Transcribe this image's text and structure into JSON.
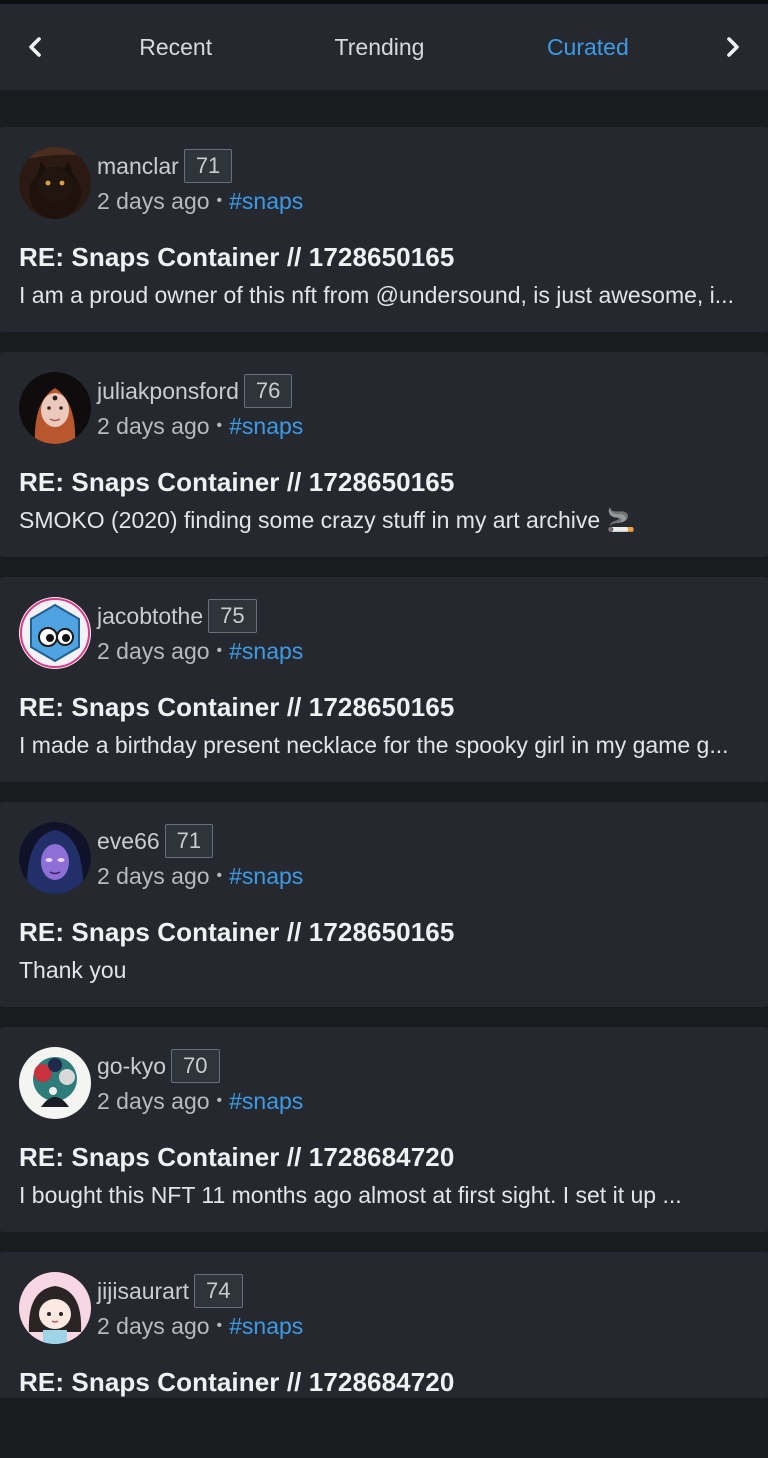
{
  "tabs": {
    "prev_icon": "chevron-left-icon",
    "next_icon": "chevron-right-icon",
    "items": [
      {
        "label": "Recent",
        "active": false
      },
      {
        "label": "Trending",
        "active": false
      },
      {
        "label": "Curated",
        "active": true
      }
    ]
  },
  "colors": {
    "accent": "#3d9ae6",
    "card_bg": "#25292f",
    "page_bg": "#191b1e"
  },
  "posts": [
    {
      "author": "manclar",
      "reputation": "71",
      "time": "2 days ago",
      "separator": "•",
      "tag": "#snaps",
      "title": "RE: Snaps Container // 1728650165",
      "excerpt": "I am a proud owner of this nft from @undersound, is just awesome, i..."
    },
    {
      "author": "juliakponsford",
      "reputation": "76",
      "time": "2 days ago",
      "separator": "•",
      "tag": "#snaps",
      "title": "RE: Snaps Container // 1728650165",
      "excerpt": "SMOKO (2020) finding some crazy stuff in my art archive 🚬"
    },
    {
      "author": "jacobtothe",
      "reputation": "75",
      "time": "2 days ago",
      "separator": "•",
      "tag": "#snaps",
      "title": "RE: Snaps Container // 1728650165",
      "excerpt": "I made a birthday present necklace for the spooky girl in my game g..."
    },
    {
      "author": "eve66",
      "reputation": "71",
      "time": "2 days ago",
      "separator": "•",
      "tag": "#snaps",
      "title": "RE: Snaps Container // 1728650165",
      "excerpt": "Thank you"
    },
    {
      "author": "go-kyo",
      "reputation": "70",
      "time": "2 days ago",
      "separator": "•",
      "tag": "#snaps",
      "title": "RE: Snaps Container // 1728684720",
      "excerpt": "I bought this NFT 11 months ago almost at first sight. I set it up ..."
    },
    {
      "author": "jijisaurart",
      "reputation": "74",
      "time": "2 days ago",
      "separator": "•",
      "tag": "#snaps",
      "title": "RE: Snaps Container // 1728684720",
      "excerpt": ""
    }
  ]
}
